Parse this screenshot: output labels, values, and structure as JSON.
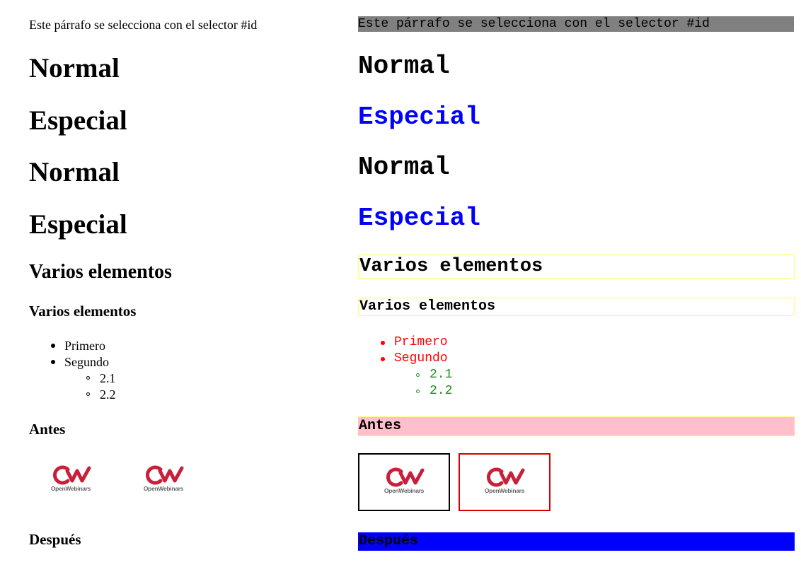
{
  "paragraph": {
    "text": "Este párrafo se selecciona con el selector #id"
  },
  "headings": {
    "h1_1": "Normal",
    "h1_2": "Especial",
    "h1_3": "Normal",
    "h1_4": "Especial",
    "h2": "Varios elementos",
    "h3": "Varios elementos"
  },
  "list": {
    "items": [
      "Primero",
      "Segundo"
    ],
    "subitems": [
      "2.1",
      "2.2"
    ]
  },
  "antes": {
    "label": "Antes"
  },
  "despues": {
    "label": "Después"
  },
  "logos": {
    "brand": "OpenWebinars"
  },
  "colors": {
    "paragraph_bg": "#808080",
    "especial": "#0000ff",
    "list_level1": "#ff0000",
    "list_level2": "#228b22",
    "heading_border": "#ffff66",
    "antes_bg": "#ffc0cb",
    "despues_bg": "#0000ff",
    "logo_red": "#c8203a",
    "logo_box1_border": "#000000",
    "logo_box2_border": "#d40000"
  }
}
